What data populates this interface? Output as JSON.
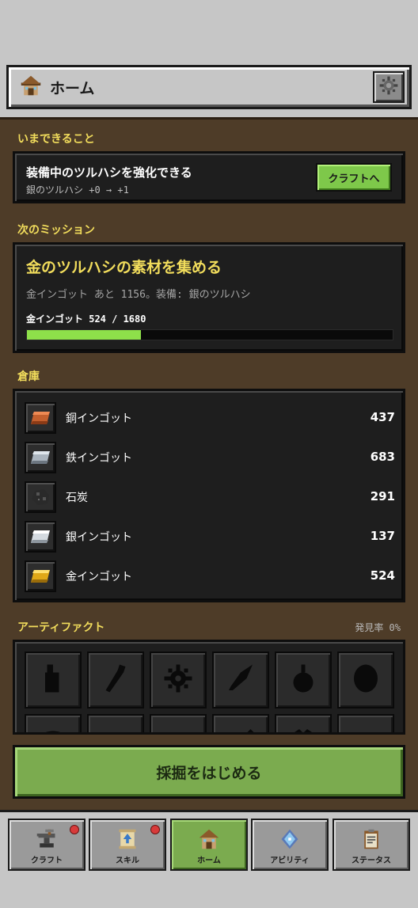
{
  "header": {
    "title": "ホーム",
    "home_icon": "house-icon",
    "settings_icon": "gear-icon"
  },
  "now": {
    "section_label": "いまできること",
    "title": "装備中のツルハシを強化できる",
    "subtitle": "銀のツルハシ +0 → +1",
    "button_label": "クラフトへ"
  },
  "mission": {
    "section_label": "次のミッション",
    "title": "金のツルハシの素材を集める",
    "description": "金インゴット あと 1156。装備: 銀のツルハシ",
    "progress_label": "金インゴット 524 / 1680",
    "progress_current": 524,
    "progress_total": 1680
  },
  "storage": {
    "section_label": "倉庫",
    "items": [
      {
        "name": "銅インゴット",
        "count": "437",
        "icon": "copper-ingot-icon",
        "color": "#c4602e"
      },
      {
        "name": "鉄インゴット",
        "count": "683",
        "icon": "iron-ingot-icon",
        "color": "#b7c0c8"
      },
      {
        "name": "石炭",
        "count": "291",
        "icon": "coal-icon",
        "color": "#3a3a3a"
      },
      {
        "name": "銀インゴット",
        "count": "137",
        "icon": "silver-ingot-icon",
        "color": "#e4e8ec"
      },
      {
        "name": "金インゴット",
        "count": "524",
        "icon": "gold-ingot-icon",
        "color": "#e6b020"
      }
    ]
  },
  "artifacts": {
    "section_label": "アーティファクト",
    "discovery_rate": "発見率 0%",
    "slots": [
      "bottle-silhouette-icon",
      "pickaxe-handle-silhouette-icon",
      "gear-silhouette-icon",
      "feather-silhouette-icon",
      "pendant-silhouette-icon",
      "shell-silhouette-icon",
      "mushroom-silhouette-icon",
      "dome-silhouette-icon",
      "leaf-silhouette-icon",
      "blade-silhouette-icon",
      "crystal-silhouette-icon",
      "orb-silhouette-icon"
    ]
  },
  "mine_button_label": "採掘をはじめる",
  "nav": [
    {
      "label": "クラフト",
      "icon": "anvil-icon",
      "badge": true,
      "active": false
    },
    {
      "label": "スキル",
      "icon": "scroll-icon",
      "badge": true,
      "active": false
    },
    {
      "label": "ホーム",
      "icon": "house-icon",
      "badge": false,
      "active": true
    },
    {
      "label": "アビリティ",
      "icon": "crystal-icon",
      "badge": false,
      "active": false
    },
    {
      "label": "ステータス",
      "icon": "clipboard-icon",
      "badge": false,
      "active": false
    }
  ]
}
